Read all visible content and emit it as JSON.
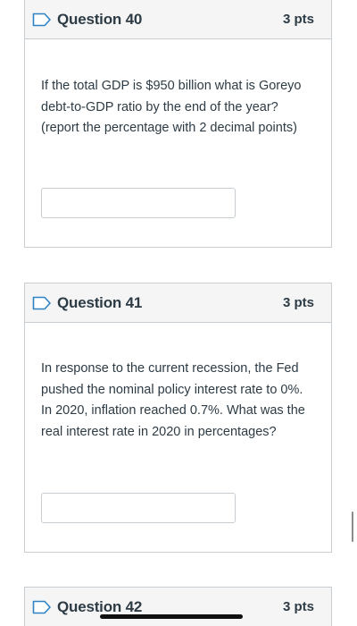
{
  "questions": [
    {
      "title": "Question 40",
      "points": "3 pts",
      "text": "If the total GDP is $950 billion what is Goreyo debt-to-GDP ratio by the end of the year? (report the percentage with 2 decimal points)",
      "answer_value": ""
    },
    {
      "title": "Question 41",
      "points": "3 pts",
      "text": "In response to the current recession, the Fed pushed the nominal policy interest rate to 0%. In 2020, inflation reached 0.7%. What was the real interest rate in 2020 in percentages?",
      "answer_value": ""
    },
    {
      "title": "Question 42",
      "points": "3 pts"
    }
  ],
  "icons": {
    "flag": "flag-question-icon"
  },
  "colors": {
    "border": "#c7cdd1",
    "header_bg": "#f5f5f5",
    "text": "#2d3b45"
  }
}
